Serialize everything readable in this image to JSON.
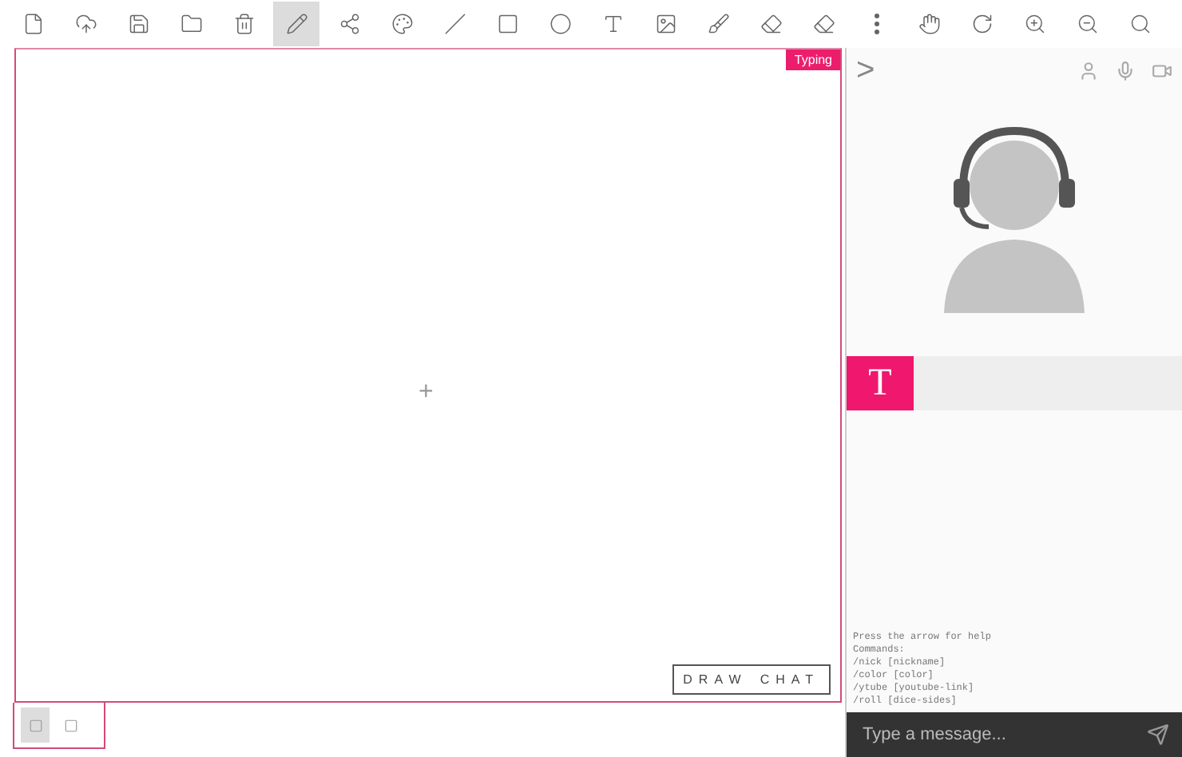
{
  "toolbar": {
    "tools": [
      {
        "kind": "new",
        "selected": false
      },
      {
        "kind": "upload",
        "selected": false
      },
      {
        "kind": "save",
        "selected": false
      },
      {
        "kind": "open",
        "selected": false
      },
      {
        "kind": "trash",
        "selected": false
      },
      {
        "kind": "pencil",
        "selected": true
      },
      {
        "kind": "share",
        "selected": false
      },
      {
        "kind": "palette",
        "selected": false
      },
      {
        "kind": "line",
        "selected": false
      },
      {
        "kind": "rect",
        "selected": false
      },
      {
        "kind": "ellipse",
        "selected": false
      },
      {
        "kind": "text",
        "selected": false
      },
      {
        "kind": "image",
        "selected": false
      },
      {
        "kind": "brush",
        "selected": false
      },
      {
        "kind": "eraser",
        "selected": false
      },
      {
        "kind": "eraser2",
        "selected": false
      },
      {
        "kind": "more",
        "selected": false
      },
      {
        "kind": "hand",
        "selected": false
      },
      {
        "kind": "rotate",
        "selected": false
      },
      {
        "kind": "zoomin",
        "selected": false
      },
      {
        "kind": "zoomout",
        "selected": false
      },
      {
        "kind": "zoomfit",
        "selected": false
      }
    ]
  },
  "canvas": {
    "badge": "Typing",
    "crosshair": "+",
    "pages": [
      {
        "selected": true
      },
      {
        "selected": false
      }
    ],
    "logo": {
      "left": "DRAW",
      "right": "CHAT"
    }
  },
  "chat": {
    "collapse": ">",
    "controls": [
      {
        "kind": "user"
      },
      {
        "kind": "mic"
      },
      {
        "kind": "camera"
      }
    ],
    "users": [
      {
        "initial": "T",
        "color": "#f0176e"
      }
    ],
    "help": [
      "Press the arrow for help",
      "Commands:",
      "/nick [nickname]",
      "/color [color]",
      "/ytube [youtube-link]",
      "/roll [dice-sides]"
    ],
    "input": {
      "placeholder": "Type a message..."
    }
  }
}
